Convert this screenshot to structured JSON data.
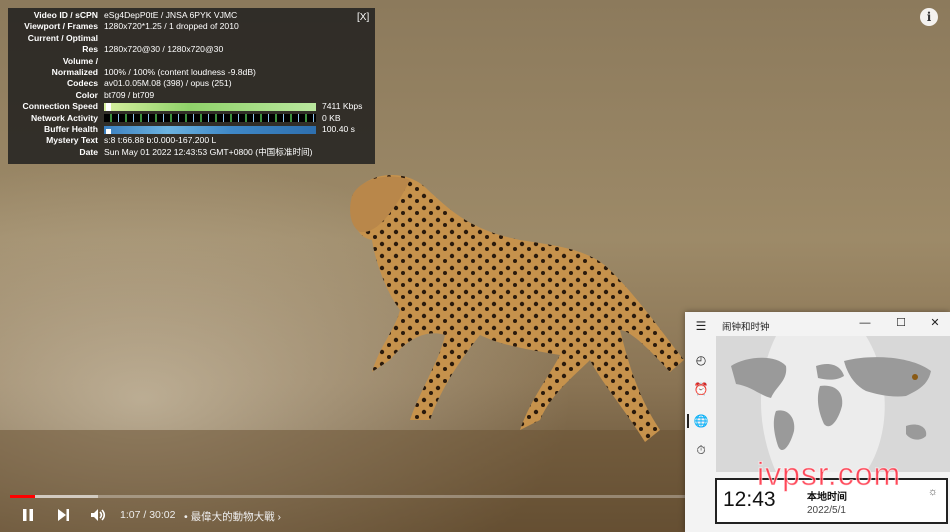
{
  "stats": {
    "close_label": "[X]",
    "rows": [
      {
        "label": "Video ID / sCPN",
        "value": "eSg4DepP0tE / JNSA 6PYK VJMC"
      },
      {
        "label": "Viewport / Frames",
        "value": "1280x720*1.25 / 1 dropped of 2010"
      },
      {
        "label": "Current / Optimal",
        "value": ""
      },
      {
        "label": "Res",
        "value": "1280x720@30 / 1280x720@30"
      },
      {
        "label": "Volume /",
        "value": ""
      },
      {
        "label": "Normalized",
        "value": "100% / 100% (content loudness -9.8dB)"
      },
      {
        "label": "Codecs",
        "value": "av01.0.05M.08 (398) / opus (251)"
      },
      {
        "label": "Color",
        "value": "bt709 / bt709"
      }
    ],
    "graphs": [
      {
        "label": "Connection Speed",
        "value": "7411 Kbps"
      },
      {
        "label": "Network Activity",
        "value": "0 KB"
      },
      {
        "label": "Buffer Health",
        "value": "100.40 s"
      }
    ],
    "rows2": [
      {
        "label": "Mystery Text",
        "value": "s:8 t:66.88 b:0.000-167.200 L"
      },
      {
        "label": "Date",
        "value": "Sun May 01 2022 12:43:53 GMT+0800 (中国标准时间)"
      }
    ]
  },
  "player": {
    "time": "1:07 / 30:02",
    "chapter": "• 最偉大的動物大戰",
    "progress": 0.037,
    "loaded": 0.13,
    "info_icon": "i"
  },
  "clock_app": {
    "title": "闹钟和时钟",
    "clock_time": "12:43",
    "clock_name": "本地时间",
    "clock_date": "2022/5/1"
  },
  "watermark": "ivpsr.com"
}
